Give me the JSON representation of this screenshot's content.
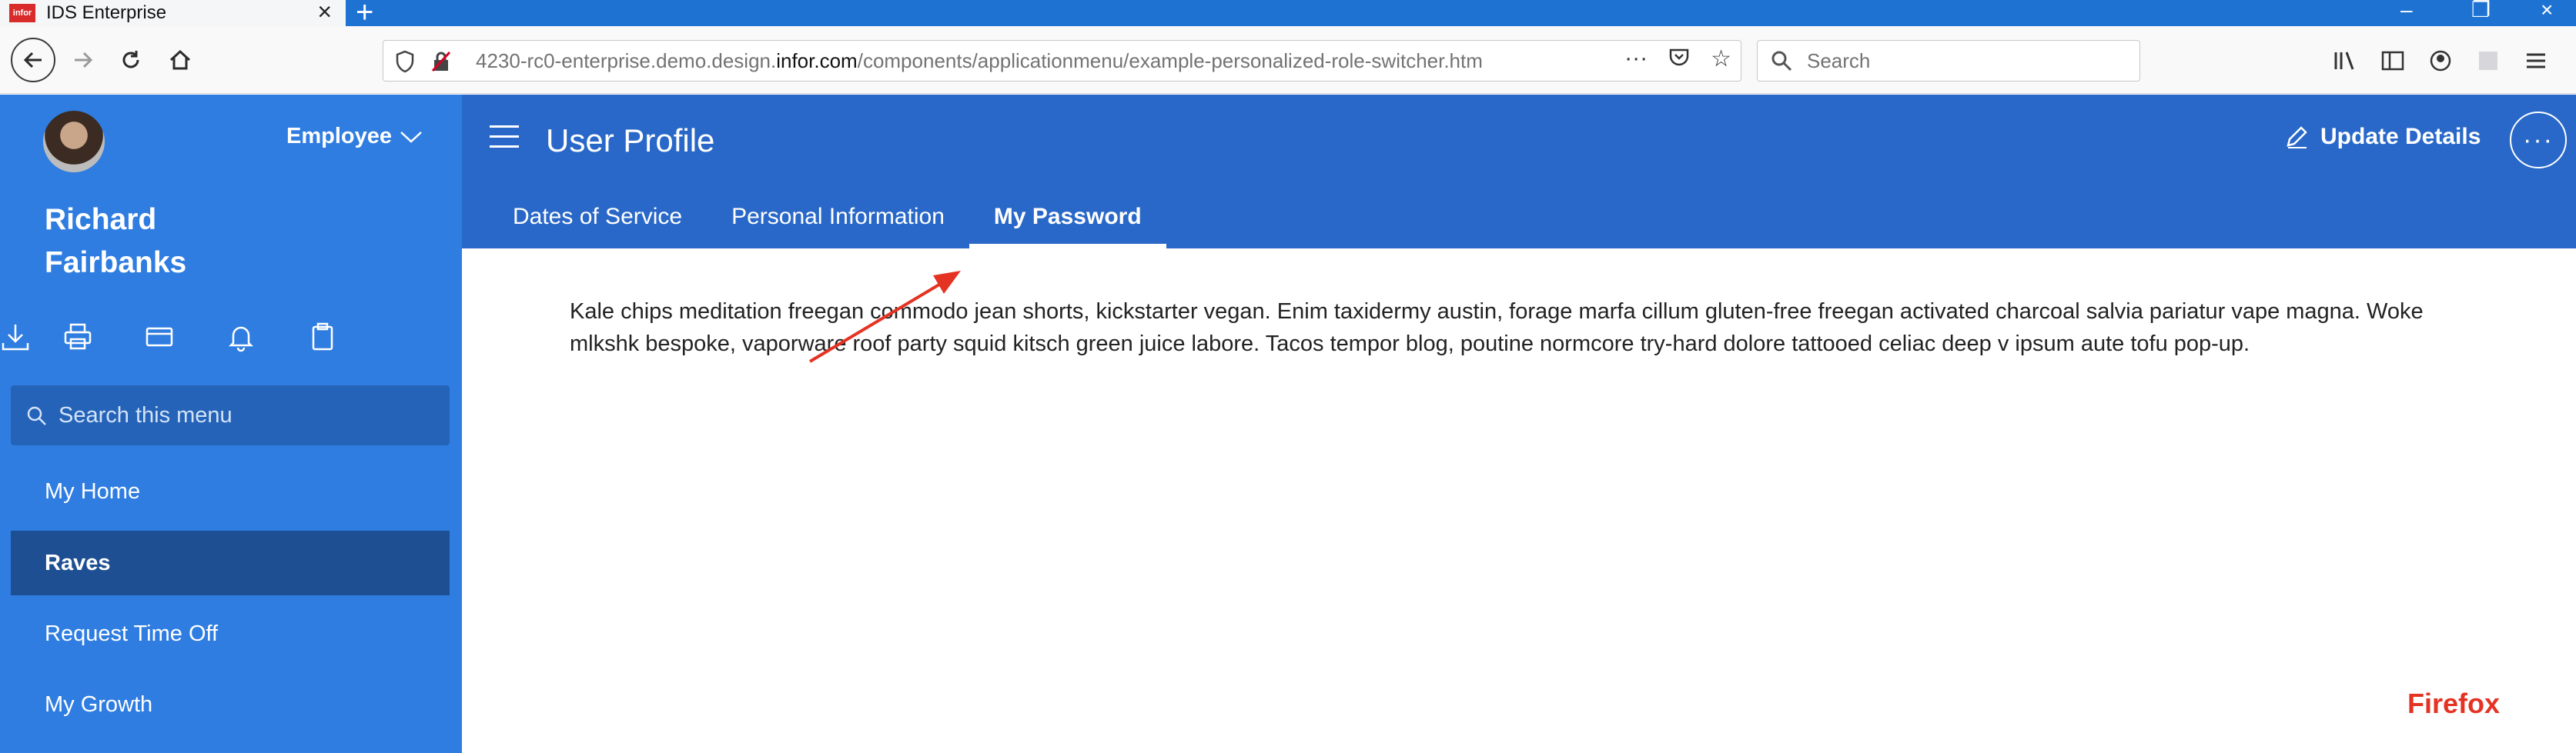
{
  "browser": {
    "tab_title": "IDS Enterprise",
    "tab_favicon_text": "infor",
    "url_prefix": "4230-rc0-enterprise.demo.design.",
    "url_host": "infor.com",
    "url_path": "/components/applicationmenu/example-personalized-role-switcher.htm",
    "search_placeholder": "Search",
    "accent_color": "#1e73d2"
  },
  "sidebar": {
    "role": "Employee",
    "user_name": "Richard Fairbanks",
    "quick_icons": [
      "download-icon",
      "print-icon",
      "card-icon",
      "bell-icon",
      "clipboard-icon"
    ],
    "search_placeholder": "Search this menu",
    "items": [
      {
        "label": "My Home",
        "active": false
      },
      {
        "label": "Raves",
        "active": true
      },
      {
        "label": "Request Time Off",
        "active": false
      },
      {
        "label": "My Growth",
        "active": false
      }
    ],
    "background_color": "#2f7de1",
    "active_color": "#1d4f92"
  },
  "header": {
    "title": "User Profile",
    "update_label": "Update Details",
    "more_label": "···",
    "tabs": [
      {
        "label": "Dates of Service",
        "active": false
      },
      {
        "label": "Personal Information",
        "active": false
      },
      {
        "label": "My Password",
        "active": true
      }
    ],
    "background_color": "#2968c8"
  },
  "content": {
    "paragraph": "Kale chips meditation freegan commodo jean shorts, kickstarter vegan. Enim taxidermy austin, forage marfa cillum gluten-free freegan activated charcoal salvia pariatur vape magna. Woke mlkshk bespoke, vaporware roof party squid kitsch green juice labore. Tacos tempor blog, poutine normcore try-hard dolore tattooed celiac deep v ipsum aute tofu pop-up."
  },
  "annotation": {
    "label": "Firefox",
    "color": "#e53323"
  }
}
